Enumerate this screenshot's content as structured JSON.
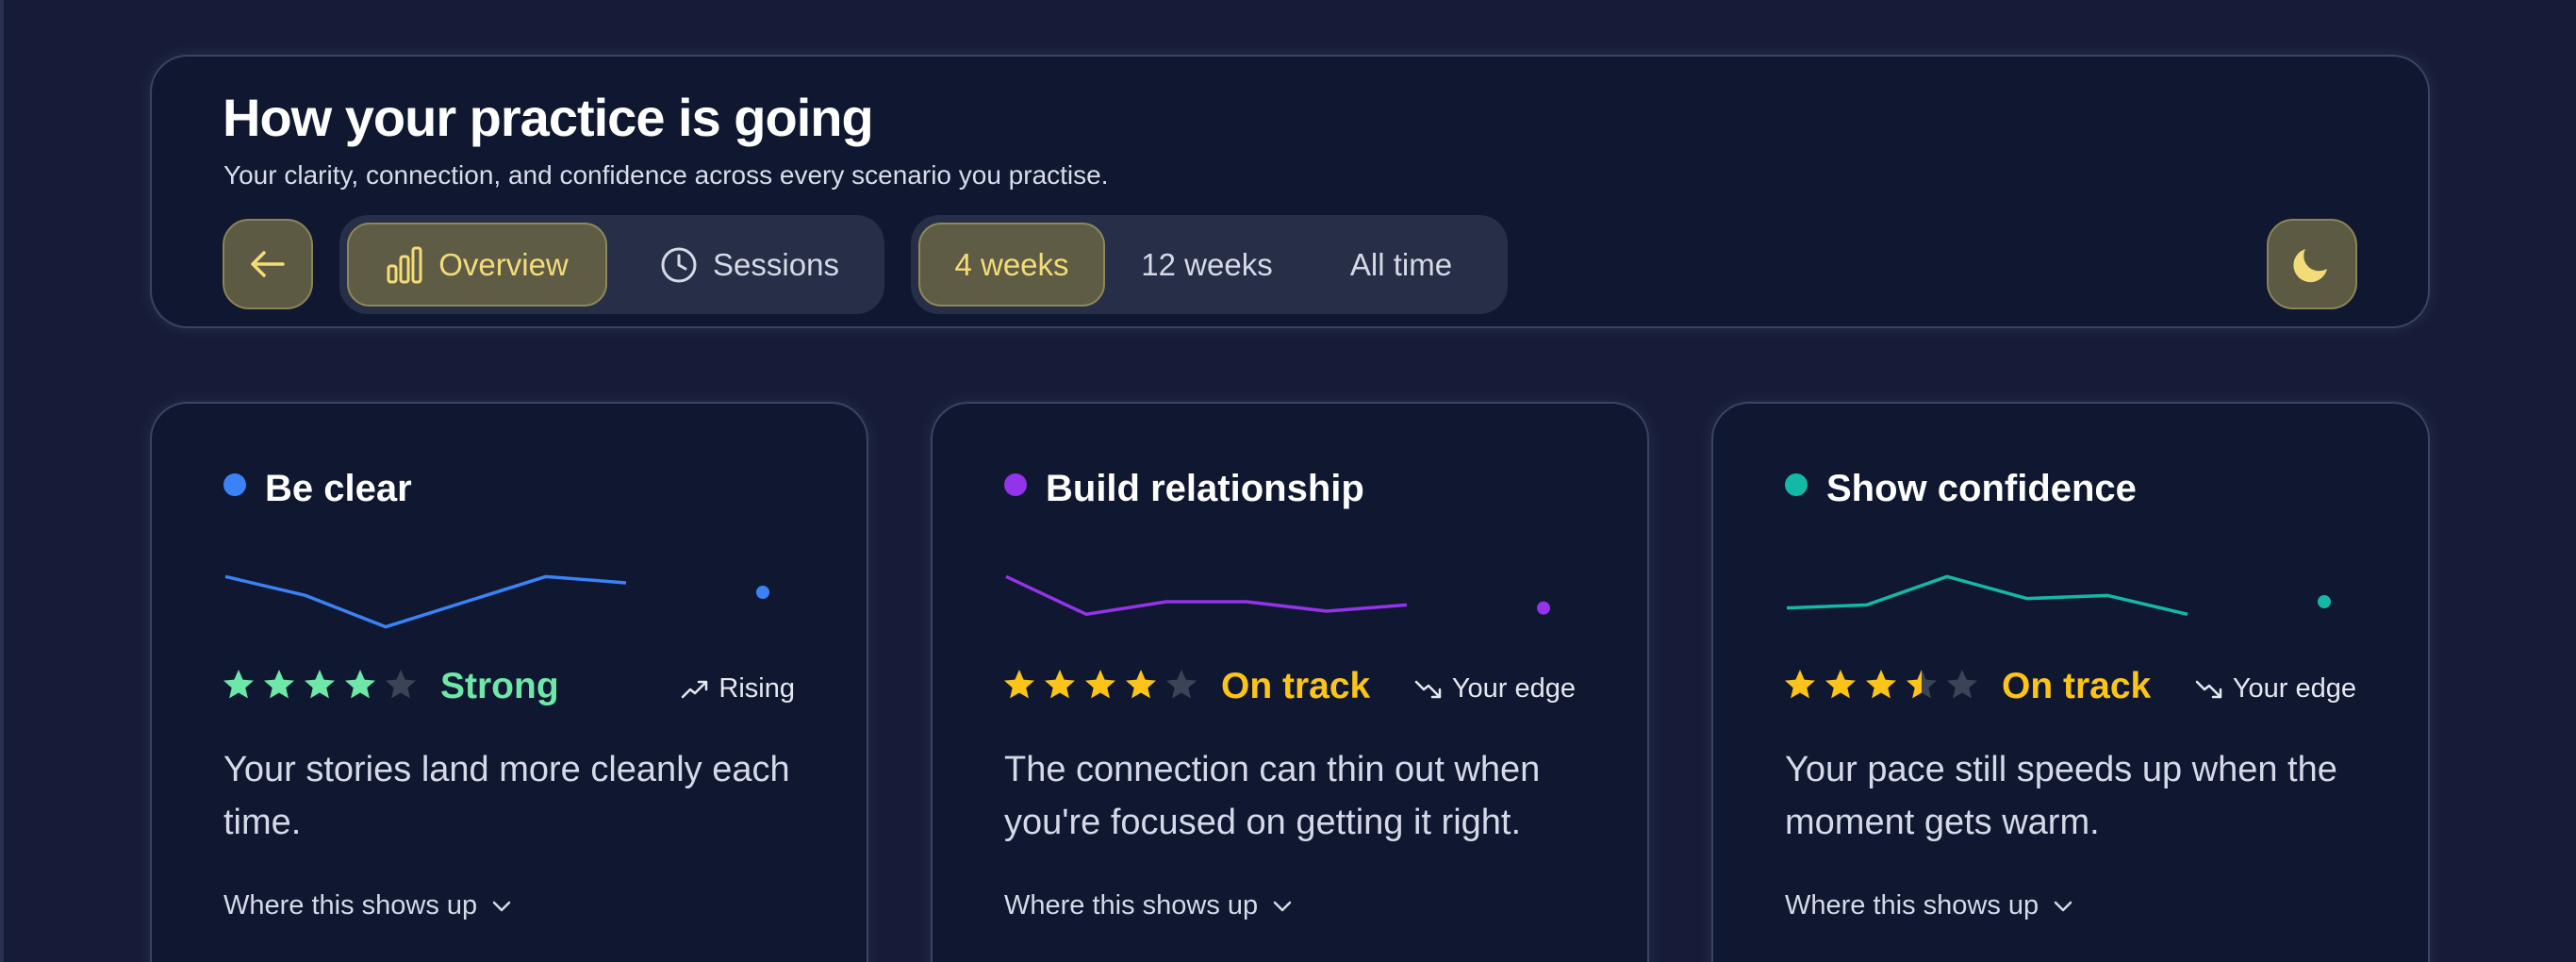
{
  "header": {
    "title": "How your practice is going",
    "subtitle": "Your clarity, connection, and confidence across every scenario you practise.",
    "back_icon": "arrow-left-icon",
    "theme_icon": "moon-icon",
    "view_tabs": [
      {
        "label": "Overview",
        "icon": "bar-chart-icon",
        "active": true
      },
      {
        "label": "Sessions",
        "icon": "clock-icon",
        "active": false
      }
    ],
    "range_tabs": [
      {
        "label": "4 weeks",
        "active": true
      },
      {
        "label": "12 weeks",
        "active": false
      },
      {
        "label": "All time",
        "active": false
      }
    ]
  },
  "colors": {
    "background": "#161b38",
    "panel": "#0f1830",
    "accent_gold": "#f3dc78",
    "star_yellow": "#fcc419",
    "star_empty": "#3b4357",
    "blue": "#3b82f6",
    "purple": "#9333ea",
    "teal": "#14b8a6",
    "strong_green": "#6ee7a8"
  },
  "cards": [
    {
      "title": "Be clear",
      "dot_color": "#3b82f6",
      "spark_values": [
        3.2,
        2.9,
        2.4,
        2.8,
        3.2,
        3.1
      ],
      "current_value": 2.95,
      "rating": 4,
      "rating_max": 5,
      "star_color": "#6ee7a8",
      "status": "Strong",
      "status_color": "#6ee7a8",
      "trend_icon": "trending-up-icon",
      "trend": "Rising",
      "description": "Your stories land more cleanly each time.",
      "expand_label": "Where this shows up"
    },
    {
      "title": "Build relationship",
      "dot_color": "#9333ea",
      "spark_values": [
        3.2,
        2.6,
        2.8,
        2.8,
        2.65,
        2.75
      ],
      "current_value": 2.7,
      "rating": 4,
      "rating_max": 5,
      "star_color": "#fcc419",
      "status": "On track",
      "status_color": "#fcc419",
      "trend_icon": "trending-down-icon",
      "trend": "Your edge",
      "description": "The connection can thin out when you're focused on getting it right.",
      "expand_label": "Where this shows up"
    },
    {
      "title": "Show confidence",
      "dot_color": "#14b8a6",
      "spark_values": [
        2.7,
        2.75,
        3.2,
        2.85,
        2.9,
        2.6
      ],
      "current_value": 2.8,
      "rating": 3.5,
      "rating_max": 5,
      "star_color": "#fcc419",
      "status": "On track",
      "status_color": "#fcc419",
      "trend_icon": "trending-down-icon",
      "trend": "Your edge",
      "description": "Your pace still speeds up when the moment gets warm.",
      "expand_label": "Where this shows up"
    }
  ]
}
